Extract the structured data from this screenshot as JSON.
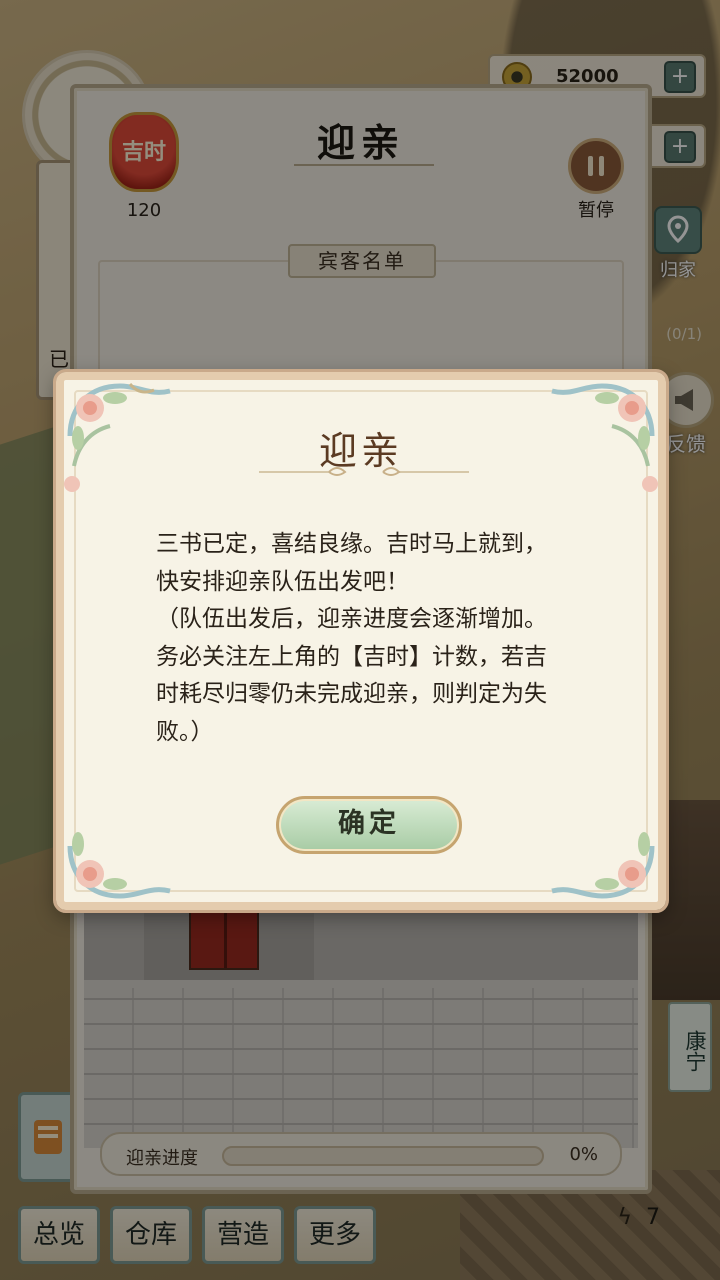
{
  "resources": {
    "coins": "52000",
    "plus": "+"
  },
  "side": {
    "home_label": "归家",
    "quota": "(0/1)",
    "feedback_label": "反馈",
    "left_scroll_text": "已公",
    "place_sign": "康宁"
  },
  "panel": {
    "title": "迎亲",
    "lucky_time_label": "吉时",
    "lucky_time_value": "120",
    "pause_label": "暂停",
    "guest_list_label": "宾客名单",
    "progress_label": "迎亲进度",
    "progress_percent": "0%",
    "progress_fraction": 0
  },
  "dialog": {
    "title": "迎亲",
    "body_line1": "三书已定，喜结良缘。吉时马上就到，快安排迎亲队伍出发吧！",
    "body_line2": "（队伍出发后，迎亲进度会逐渐增加。务必关注左上角的【吉时】计数，若吉时耗尽归零仍未完成迎亲，则判定为失败。）",
    "confirm_label": "确定"
  },
  "bottom_nav": {
    "items": [
      "总览",
      "仓库",
      "营造",
      "更多"
    ],
    "energy_value": "7"
  },
  "colors": {
    "dialog_title": "#5b3a22",
    "confirm_green": "#a7cba4",
    "lantern_red": "#e04a3a"
  }
}
